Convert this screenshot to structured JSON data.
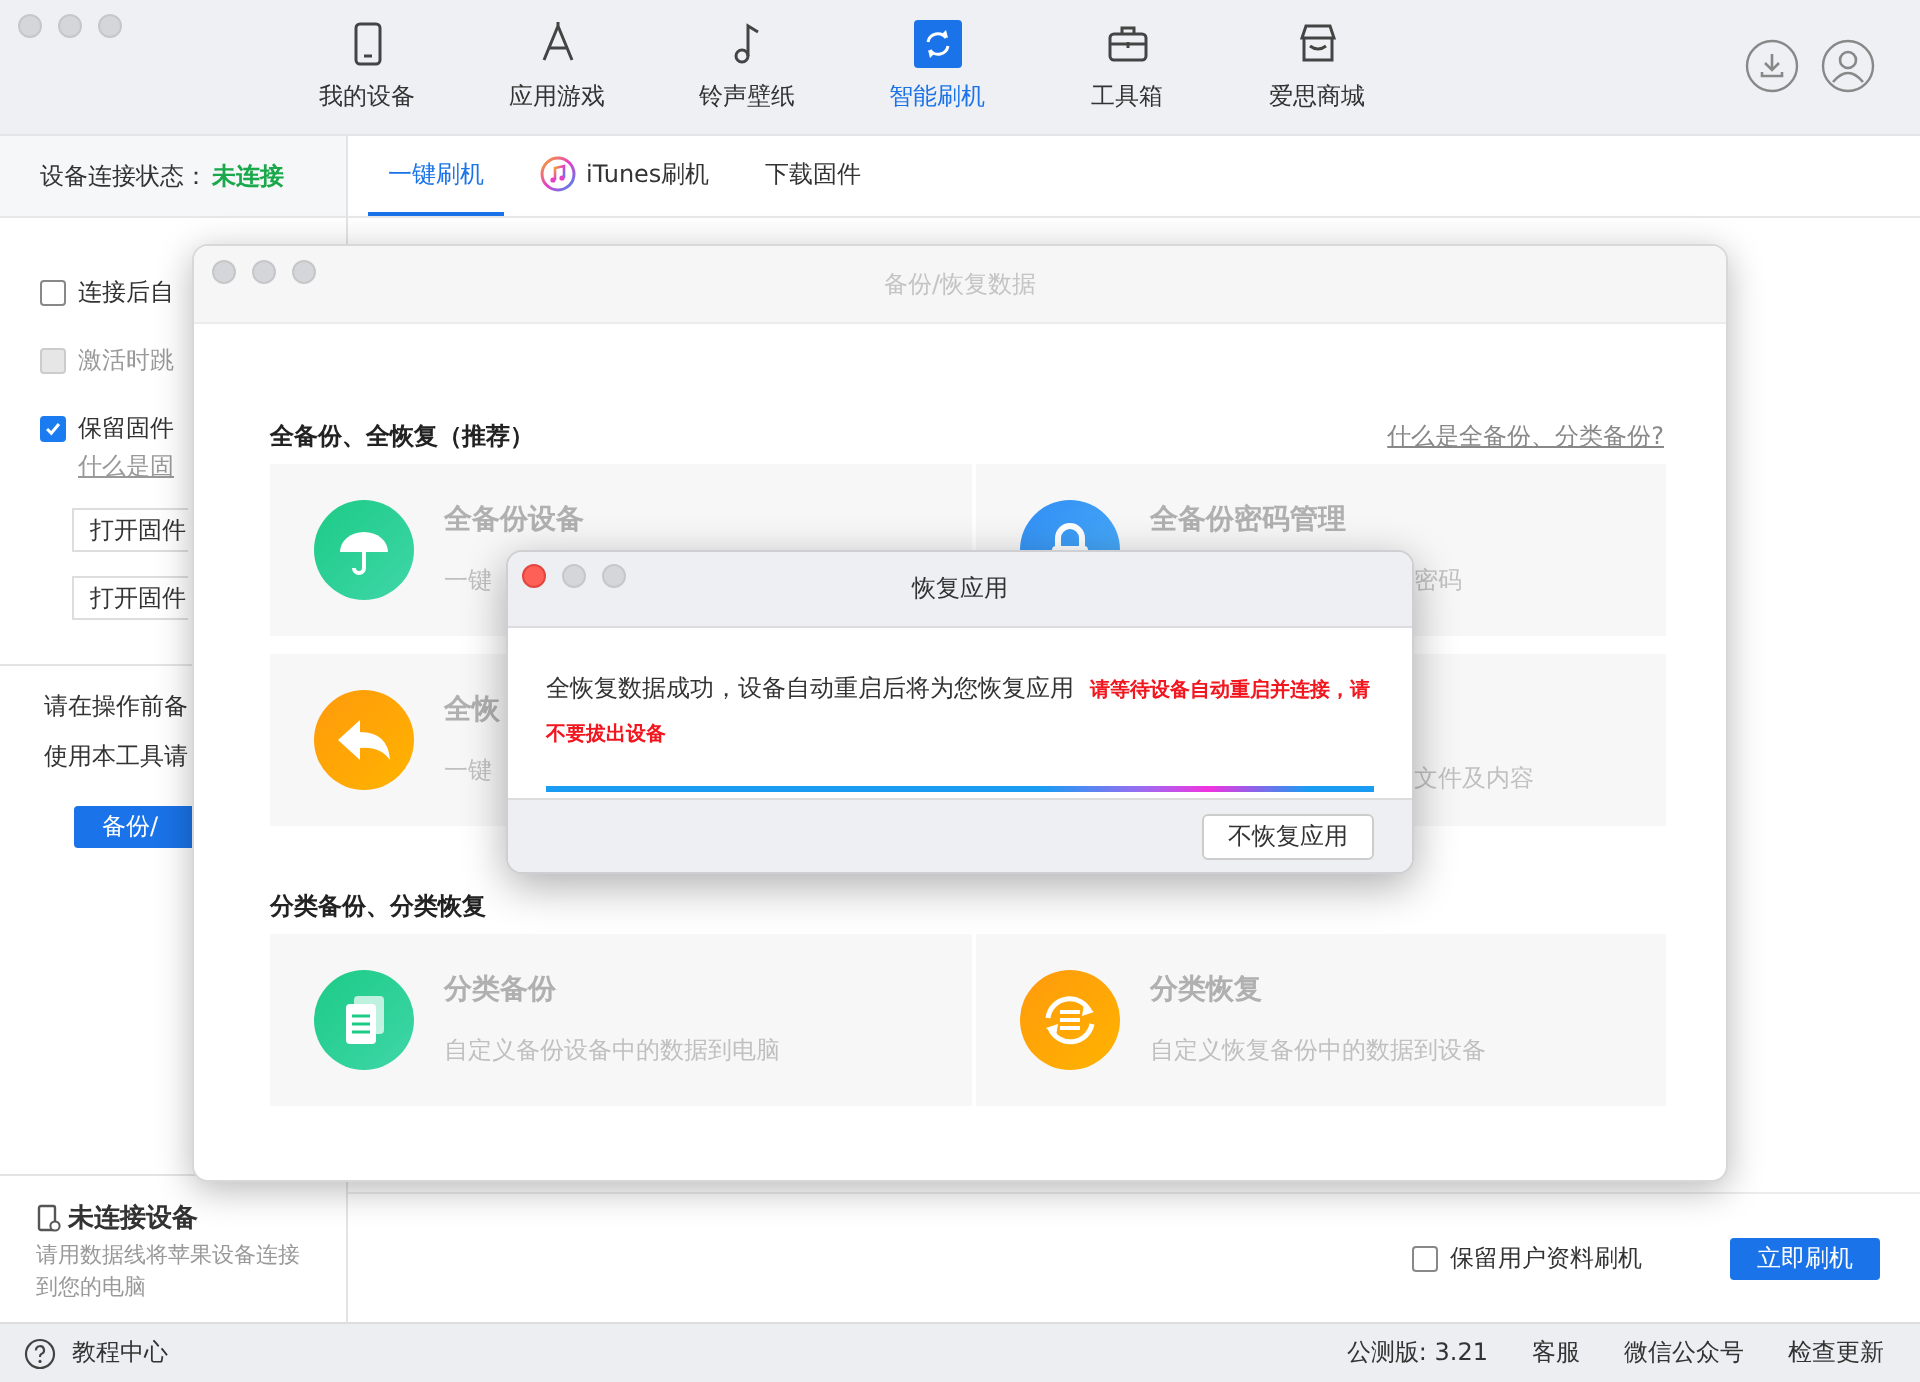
{
  "toolbar": {
    "nav": [
      {
        "label": "我的设备",
        "selected": false
      },
      {
        "label": "应用游戏",
        "selected": false
      },
      {
        "label": "铃声壁纸",
        "selected": false
      },
      {
        "label": "智能刷机",
        "selected": true
      },
      {
        "label": "工具箱",
        "selected": false
      },
      {
        "label": "爱思商城",
        "selected": false
      }
    ]
  },
  "sidebar": {
    "status_label": "设备连接状态：",
    "status_value": "未连接",
    "options": [
      {
        "label": "连接后自",
        "checked": false,
        "disabled": false
      },
      {
        "label": "激活时跳",
        "checked": false,
        "disabled": true
      },
      {
        "label": "保留固件",
        "checked": true,
        "disabled": false
      }
    ],
    "link": "什么是固",
    "buttons": [
      "打开固件",
      "打开固件"
    ],
    "notes": [
      "请在操作前备",
      "使用本工具请"
    ],
    "action_button": "备份/",
    "device": {
      "title": "未连接设备",
      "description": "请用数据线将苹果设备连接到您的电脑"
    }
  },
  "tabs": [
    {
      "label": "一键刷机",
      "selected": true,
      "kind": "plain"
    },
    {
      "label": "iTunes刷机",
      "selected": false,
      "kind": "itunes"
    },
    {
      "label": "下载固件",
      "selected": false,
      "kind": "plain"
    }
  ],
  "footer": {
    "option": {
      "label": "保留用户资料刷机",
      "checked": false
    },
    "button": "立即刷机"
  },
  "status_bar": {
    "help": "教程中心",
    "items": [
      "公测版: 3.21",
      "客服",
      "微信公众号",
      "检查更新"
    ]
  },
  "backup_window": {
    "title": "备份/恢复数据",
    "sections": [
      {
        "heading": "全备份、全恢复（推荐）",
        "link": "什么是全备份、分类备份?",
        "cards": [
          {
            "title": "全备份设备",
            "description": "一键"
          },
          {
            "title": "全备份密码管理",
            "description_end": "密码"
          },
          {
            "title": "全恢",
            "description": "一键"
          },
          {
            "description_end": "文件及内容"
          }
        ]
      },
      {
        "heading": "分类备份、分类恢复",
        "cards": [
          {
            "title": "分类备份",
            "description": "自定义备份设备中的数据到电脑"
          },
          {
            "title": "分类恢复",
            "description": "自定义恢复备份中的数据到设备"
          }
        ]
      }
    ]
  },
  "restore_dialog": {
    "title": "恢复应用",
    "message": "全恢复数据成功，设备自动重启后将为您恢复应用",
    "warning": "请等待设备自动重启并连接，请不要拔出设备",
    "progress": {
      "level": 1
    },
    "button": "不恢复应用"
  }
}
